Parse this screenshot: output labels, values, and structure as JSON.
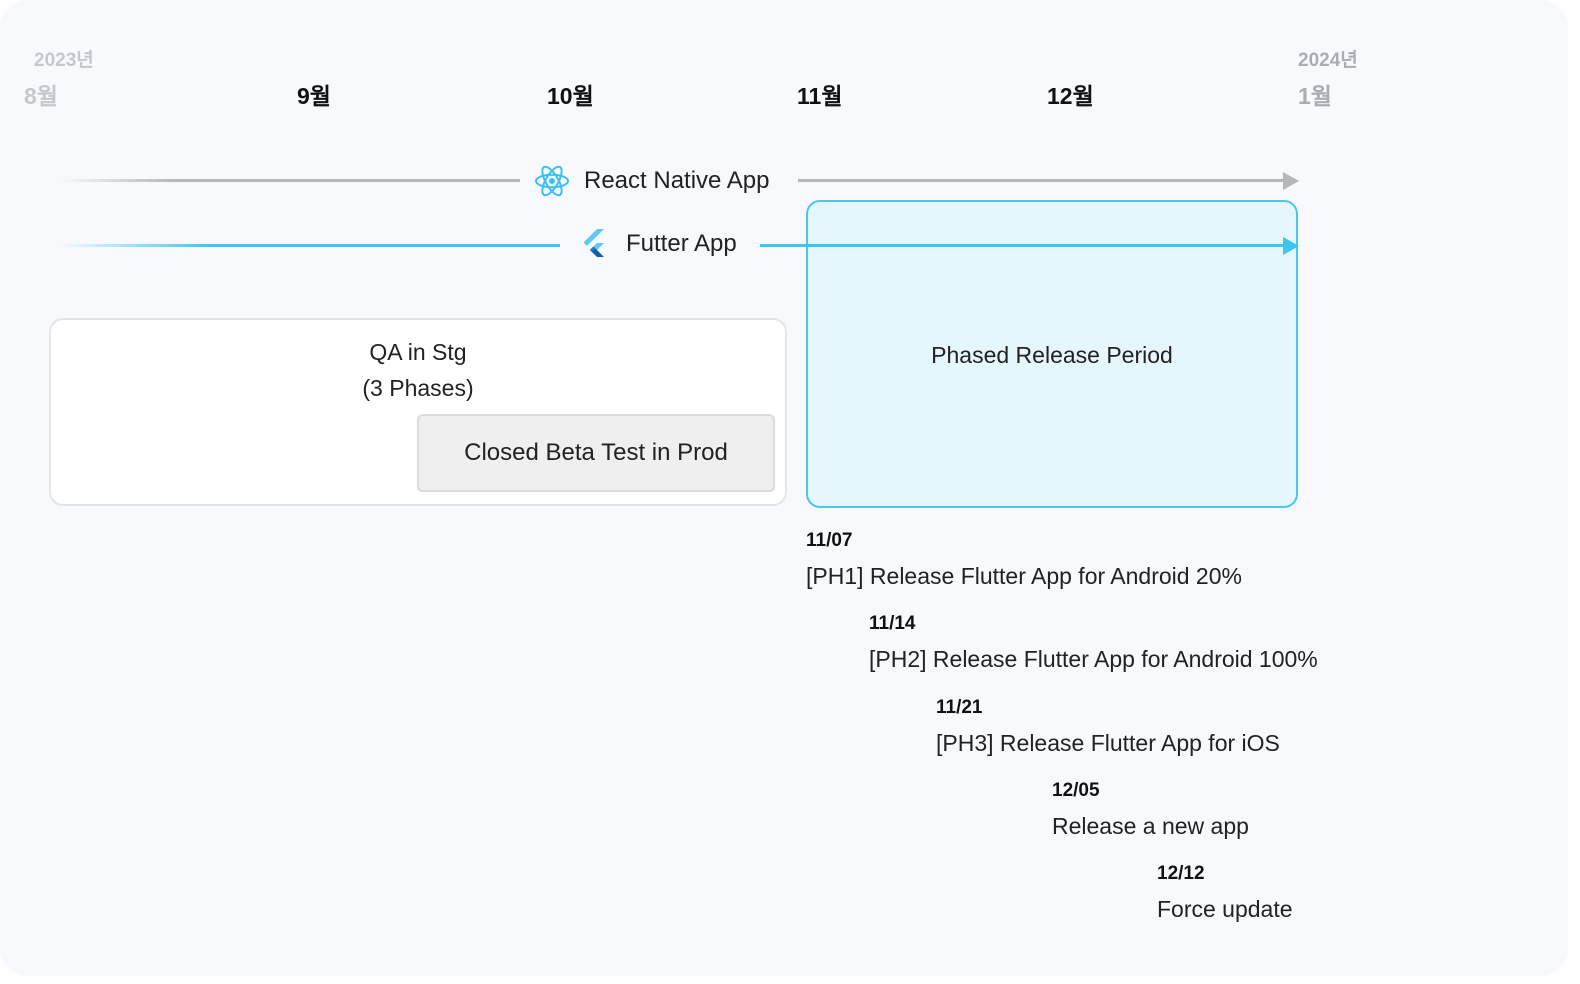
{
  "timeline": {
    "months": [
      {
        "year": "2023년",
        "name": "8월"
      },
      {
        "year": "",
        "name": "9월"
      },
      {
        "year": "",
        "name": "10월"
      },
      {
        "year": "",
        "name": "11월"
      },
      {
        "year": "",
        "name": "12월"
      },
      {
        "year": "2024년",
        "name": "1월"
      }
    ]
  },
  "tracks": {
    "react": {
      "label": "React Native App",
      "icon": "react-icon",
      "color": "#b5b7bb"
    },
    "flutter": {
      "label": "Futter App",
      "icon": "flutter-icon",
      "color": "#3ec6f3"
    }
  },
  "blocks": {
    "qa": {
      "title_line1": "QA in Stg",
      "title_line2": "(3 Phases)"
    },
    "beta": {
      "label": "Closed Beta Test in Prod"
    },
    "phased": {
      "label": "Phased Release Period"
    }
  },
  "milestones": [
    {
      "date": "11/07",
      "desc": "[PH1] Release Flutter App for Android 20%"
    },
    {
      "date": "11/14",
      "desc": "[PH2] Release Flutter App for Android 100%"
    },
    {
      "date": "11/21",
      "desc": "[PH3] Release Flutter App for iOS"
    },
    {
      "date": "12/05",
      "desc": "Release a new app"
    },
    {
      "date": "12/12",
      "desc": "Force update"
    }
  ]
}
